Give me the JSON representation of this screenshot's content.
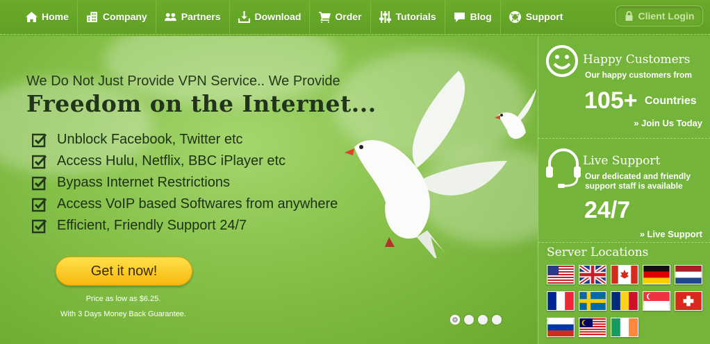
{
  "nav": {
    "items": [
      {
        "label": "Home",
        "icon": "home-icon"
      },
      {
        "label": "Company",
        "icon": "building-icon"
      },
      {
        "label": "Partners",
        "icon": "users-icon"
      },
      {
        "label": "Download",
        "icon": "download-icon"
      },
      {
        "label": "Order",
        "icon": "cart-icon"
      },
      {
        "label": "Tutorials",
        "icon": "sliders-icon"
      },
      {
        "label": "Blog",
        "icon": "chat-icon"
      },
      {
        "label": "Support",
        "icon": "lifebuoy-icon"
      }
    ],
    "client_login": "Client Login"
  },
  "hero": {
    "tagline": "We Do Not Just Provide VPN Service.. We Provide",
    "headline": "Freedom on the Internet...",
    "features": [
      "Unblock Facebook, Twitter etc",
      "Access Hulu, Netflix, BBC iPlayer etc",
      "Bypass Internet Restrictions",
      "Access VoIP based Softwares from anywhere",
      "Efficient, Friendly Support 24/7"
    ],
    "cta_label": "Get it now!",
    "price_line": "Price as low as $6.25.",
    "guarantee_line": "With 3 Days Money Back Guarantee.",
    "slide_count": 4,
    "active_slide": 1
  },
  "sidebar": {
    "happy": {
      "title": "Happy Customers",
      "subtitle": "Our happy customers from",
      "count": "105+",
      "count_suffix": "Countries",
      "link": "» Join Us Today"
    },
    "support": {
      "title": "Live Support",
      "subtitle_1": "Our dedicated and friendly",
      "subtitle_2": "support staff is available",
      "hours": "24/7",
      "link": "» Live Support"
    },
    "servers": {
      "title": "Server Locations",
      "flags": [
        "United States",
        "United Kingdom",
        "Canada",
        "Germany",
        "Netherlands",
        "France",
        "Sweden",
        "Romania",
        "Singapore",
        "Switzerland",
        "Russia",
        "Malaysia",
        "Ireland"
      ]
    }
  },
  "colors": {
    "brand_green": "#6fae2f",
    "cta_yellow": "#f6b80f"
  }
}
